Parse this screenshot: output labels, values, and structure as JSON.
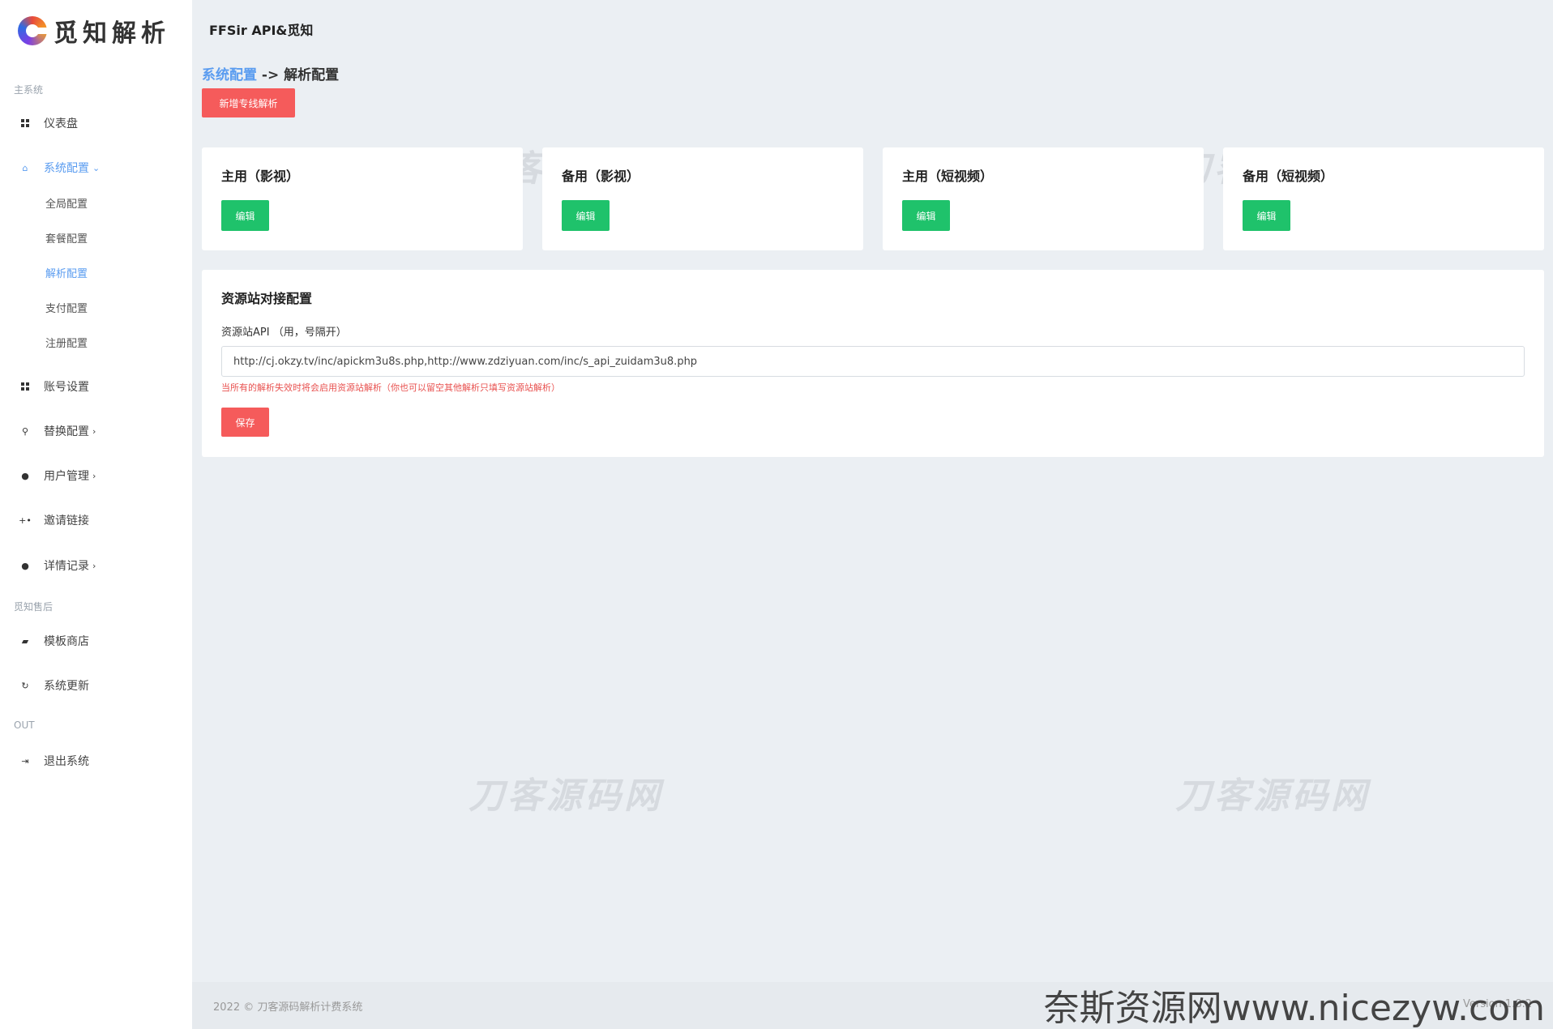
{
  "brand": {
    "logo_text": "觅知解析"
  },
  "header": {
    "title": "FFSir API&觅知"
  },
  "sidebar": {
    "section_main": "主系统",
    "dashboard": "仪表盘",
    "system_config": "系统配置",
    "sub": [
      "全局配置",
      "套餐配置",
      "解析配置",
      "支付配置",
      "注册配置"
    ],
    "account_settings": "账号设置",
    "replace_config": "替换配置",
    "user_mgmt": "用户管理",
    "invite_link": "邀请链接",
    "detail_records": "详情记录",
    "section_after": "觅知售后",
    "template_store": "模板商店",
    "system_update": "系统更新",
    "section_out": "OUT",
    "logout": "退出系统"
  },
  "breadcrumb": {
    "link": "系统配置",
    "sep": " -> ",
    "current": "解析配置"
  },
  "actions": {
    "add_label": "新增专线解析"
  },
  "cards": [
    {
      "title": "主用（影视）",
      "button": "编辑"
    },
    {
      "title": "备用（影视）",
      "button": "编辑"
    },
    {
      "title": "主用（短视频）",
      "button": "编辑"
    },
    {
      "title": "备用（短视频）",
      "button": "编辑"
    }
  ],
  "panel": {
    "title": "资源站对接配置",
    "label": "资源站API （用，号隔开）",
    "value": "http://cj.okzy.tv/inc/apickm3u8s.php,http://www.zdziyuan.com/inc/s_api_zuidam3u8.php",
    "hint": "当所有的解析失效时将会启用资源站解析（你也可以留空其他解析只填写资源站解析）",
    "save_label": "保存"
  },
  "watermark": "刀客源码网",
  "footer": {
    "copyright": "2022 © 刀客源码解析计费系统",
    "version": "Version 1.8.2"
  },
  "site_mark": "奈斯资源网www.nicezyw.com"
}
